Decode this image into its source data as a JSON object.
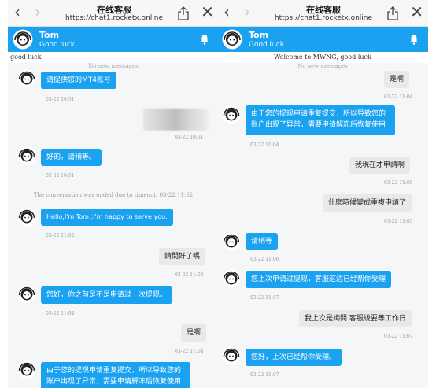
{
  "browser": {
    "title": "在线客服",
    "url": "https://chat1.rocketx.online",
    "back_glyph": "‹",
    "forward_glyph": "›",
    "close_glyph": "✕"
  },
  "header": {
    "name": "Tom",
    "status": "Good luck",
    "color": "#1aa1f0"
  },
  "left": {
    "welcome": "good luck",
    "no_new": "No new messages",
    "m1": "请提供您的MT4账号",
    "t1": "03-22 10:51",
    "t2": "03-22 10:51",
    "m3": "好的，请稍等。",
    "t3": "03-22 10:51",
    "sys": "The conversation was ended due to timeout. 03-22 11:02",
    "m4": "Hello,I'm Tom .I'm happy to serve you.",
    "t4": "03-22 11:02",
    "m5": "請問好了嗎",
    "t5": "03-22 11:03",
    "m6": "您好，你之前是不是申请过一次提现。",
    "t6": "03-22 11:04",
    "m7": "是啊",
    "t7": "03-22 11:04",
    "m8": "由于您的提现申请重复提交，所以导致您的账户出现了异常，需要申请解冻后恢复使用"
  },
  "right": {
    "welcome": "Welcome to MWNG, good luck",
    "no_new": "No new messages",
    "m1": "是啊",
    "t1": "03-22 11:04",
    "m2": "由于您的提现申请重复提交，所以导致您的账户出现了异常，需要申请解冻后恢复使用",
    "t2": "03-22 11:04",
    "m3": "我現在才申請啊",
    "t3": "03-22 11:05",
    "m4": "什麼時候變成重複申請了",
    "t4": "03-22 11:05",
    "m5": "请稍等",
    "t5": "03-22 11:06",
    "m6": "您上次申请过提现，客服这边已经帮你受理",
    "t6": "03-22 11:07",
    "m7": "我上次是詢問 客服說要等工作日",
    "t7": "03-22 11:07",
    "m8": "您好，上次已经帮你受理。",
    "t8": "03-22 11:07"
  }
}
